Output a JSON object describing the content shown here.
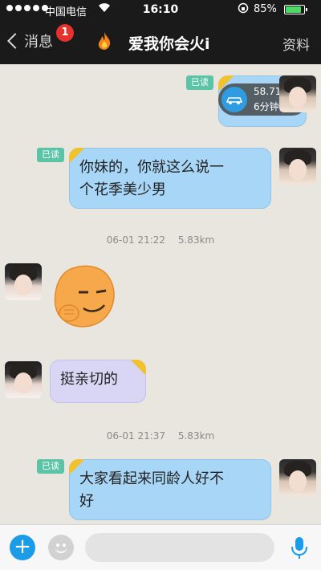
{
  "status_bar": {
    "carrier": "中国电信",
    "time": "16:10",
    "battery_percent": "85%",
    "battery_level": 0.85,
    "signal_dots_filled": 5
  },
  "nav": {
    "back_label": "消息",
    "unread_badge": "1",
    "title": "爱我你会火i",
    "profile_label": "资料"
  },
  "chat": {
    "location_card": {
      "distance": "58.71km",
      "ago": "6分钟前",
      "read_label": "已读"
    },
    "messages": [
      {
        "side": "me",
        "read_label": "已读",
        "lines": [
          "你妹的，你就这么说一",
          "个花季美少男"
        ]
      },
      {
        "side": "her",
        "type": "sticker"
      },
      {
        "side": "her",
        "lines": [
          "挺亲切的"
        ]
      },
      {
        "side": "me",
        "read_label": "已读",
        "lines": [
          "大家看起来同龄人好不",
          "好"
        ]
      }
    ],
    "timestamps": [
      {
        "time": "06-01 21:22",
        "distance": "5.83km"
      },
      {
        "time": "06-01 21:37",
        "distance": "5.83km"
      }
    ]
  },
  "input_bar": {
    "placeholder": ""
  },
  "colors": {
    "bubble_me": "#a8d6f7",
    "bubble_her": "#d9d5f4",
    "read_tag": "#5bc4a6",
    "accent_blue": "#1a9ce8",
    "badge_red": "#e5322d"
  }
}
